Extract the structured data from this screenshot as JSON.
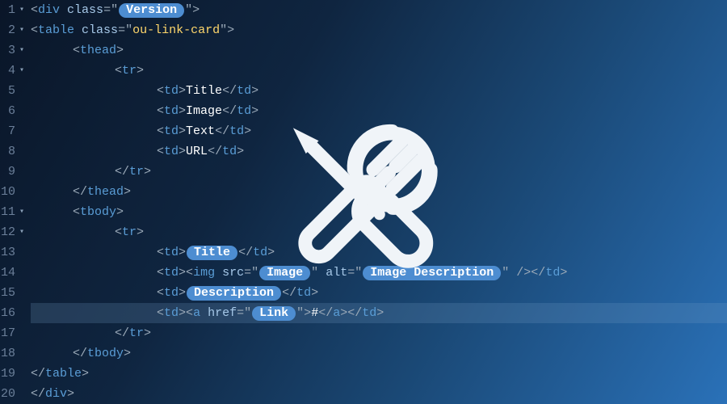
{
  "lines": {
    "l1": {
      "num": "1",
      "fold": "▾",
      "class_val": "Version",
      "div_class_attr": "class"
    },
    "l2": {
      "num": "2",
      "fold": "▾",
      "table_class": "ou-link-card",
      "table_class_attr": "class"
    },
    "l3": {
      "num": "3",
      "fold": "▾"
    },
    "l4": {
      "num": "4",
      "fold": "▾"
    },
    "l5": {
      "num": "5",
      "txt": "Title"
    },
    "l6": {
      "num": "6",
      "txt": "Image"
    },
    "l7": {
      "num": "7",
      "txt": "Text"
    },
    "l8": {
      "num": "8",
      "txt": "URL"
    },
    "l9": {
      "num": "9"
    },
    "l10": {
      "num": "10"
    },
    "l11": {
      "num": "11",
      "fold": "▾"
    },
    "l12": {
      "num": "12",
      "fold": "▾"
    },
    "l13": {
      "num": "13",
      "pill": "Title"
    },
    "l14": {
      "num": "14",
      "src_attr": "src",
      "src_pill": "Image",
      "alt_attr": "alt",
      "alt_pill": "Image Description"
    },
    "l15": {
      "num": "15",
      "pill": "Description"
    },
    "l16": {
      "num": "16",
      "href_attr": "href",
      "href_pill": "Link",
      "anchor_txt": "#"
    },
    "l17": {
      "num": "17"
    },
    "l18": {
      "num": "18"
    },
    "l19": {
      "num": "19"
    },
    "l20": {
      "num": "20"
    }
  },
  "tags": {
    "div": "div",
    "table": "table",
    "thead": "thead",
    "tbody": "tbody",
    "tr": "tr",
    "td": "td",
    "img": "img",
    "a": "a"
  },
  "punct": {
    "lt": "<",
    "gt": ">",
    "lts": "</",
    "sgt": " />",
    "eq": "=",
    "q": "\"",
    "sp": " "
  },
  "icon": {
    "name": "tools-icon"
  }
}
